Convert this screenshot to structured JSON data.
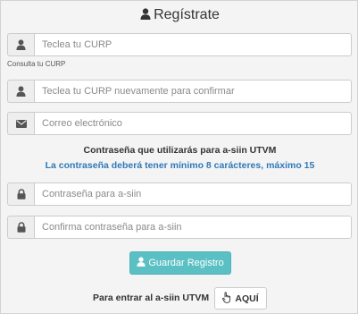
{
  "title": {
    "icon": "user-icon",
    "text": "Regístrate"
  },
  "fields": {
    "curp": {
      "icon": "user-icon",
      "placeholder": "Teclea tu CURP",
      "value": "",
      "help": "Consulta tu CURP"
    },
    "curp_confirm": {
      "icon": "user-icon",
      "placeholder": "Teclea tu CURP nuevamente para confirmar",
      "value": ""
    },
    "email": {
      "icon": "envelope-icon",
      "placeholder": "Correo electrónico",
      "value": ""
    },
    "password": {
      "icon": "lock-icon",
      "placeholder": "Contraseña para a-siin",
      "value": ""
    },
    "password_confirm": {
      "icon": "lock-icon",
      "placeholder": "Confirma contraseña para a-siin",
      "value": ""
    }
  },
  "password_info": {
    "title": "Contraseña que utilizarás para a-siin UTVM",
    "rule": "La contraseña deberá tener mínimo 8 carácteres, máximo 15"
  },
  "save_button": {
    "icon": "user-icon",
    "label": "Guardar Registro"
  },
  "login": {
    "label": "Para entrar al a-siin UTVM",
    "button_icon": "hand-pointer-icon",
    "button_label": "AQUÍ"
  },
  "colors": {
    "panel_bg": "#f4f4f4",
    "addon_bg": "#eeeeee",
    "border": "#cccccc",
    "accent": "#5bc0c4",
    "info_text": "#2f79b8"
  }
}
